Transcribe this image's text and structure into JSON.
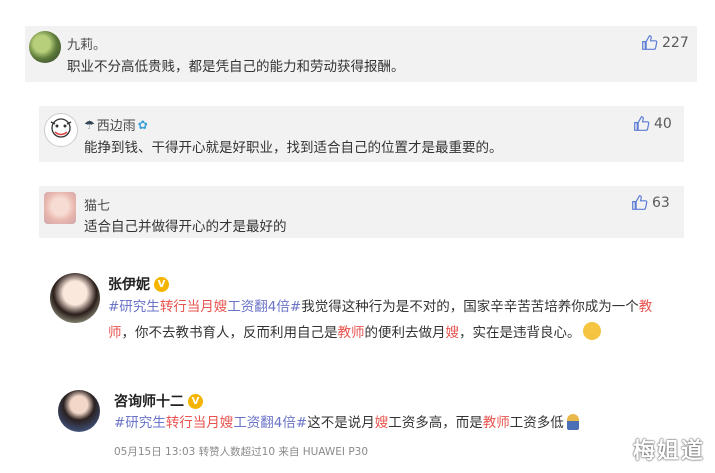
{
  "comments": [
    {
      "name": "九莉。",
      "text": "职业不分高低贵贱，都是凭自己的能力和劳动获得报酬。",
      "likes": "227"
    },
    {
      "name": "西边雨",
      "text": "能挣到钱、干得开心就是好职业，找到适合自己的位置才是最重要的。",
      "likes": "40"
    },
    {
      "name": "猫七",
      "text": "适合自己并做得开心的才是最好的",
      "likes": "63"
    }
  ],
  "post1": {
    "name": "张伊妮",
    "tag1": "#研究生",
    "hl1": "转行当月嫂",
    "tag1b": "工资翻4倍#",
    "text1": "我觉得这种行为是不对的，国家辛辛苦苦培养你成为一个",
    "hl2": "教",
    "hl3": "师",
    "text2": "，你不去教书育人，反而利用自己是",
    "hl4": "教师",
    "text3": "的便利去做月",
    "hl5": "嫂",
    "text4": "，实在是违背良心。",
    "emoji": "🙂"
  },
  "post2": {
    "name": "咨询师十二",
    "tag1": "#研究生",
    "hl1": "转行当月嫂",
    "tag1b": "工资翻4倍#",
    "text1": "这不是说月",
    "hl2": "嫂",
    "text2": "工资多高，而是",
    "hl3": "教师",
    "text3": "工资多低",
    "meta": "05月15日 13:03  转赞人数超过10  来自 HUAWEI P30"
  },
  "watermark": "梅姐道",
  "colors": {
    "card_bg": "#f2f2f2",
    "tag": "#6b74c9",
    "highlight": "#e8534e",
    "badge": "#f4b400"
  }
}
